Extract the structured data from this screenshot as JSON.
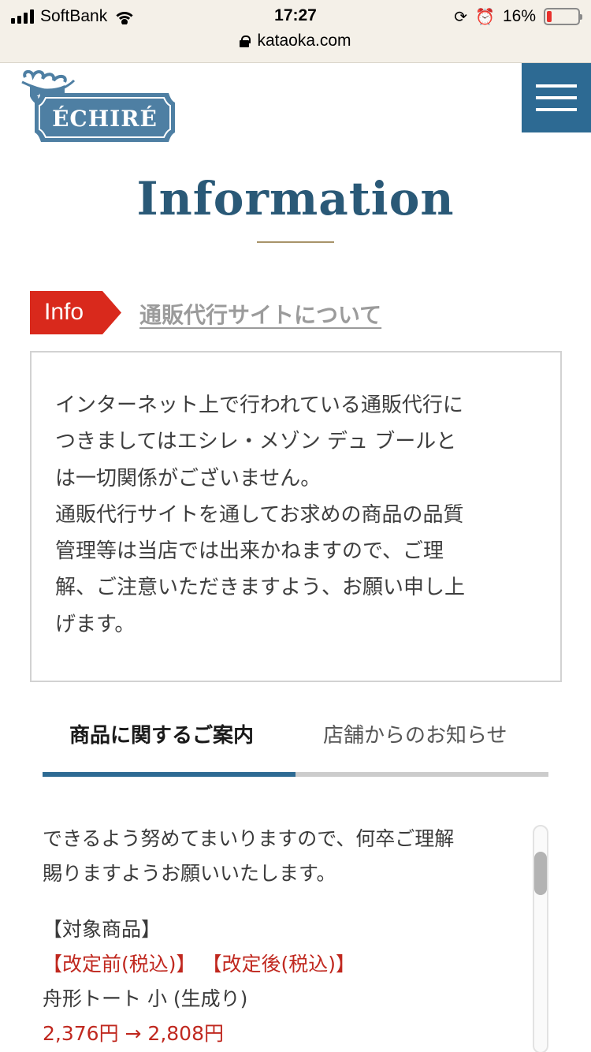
{
  "status_bar": {
    "carrier": "SoftBank",
    "time": "17:27",
    "url": "kataoka.com",
    "battery_percent": "16%",
    "battery_level": 0.16,
    "icons": [
      "signal-icon",
      "wifi-icon",
      "rotation-lock-icon",
      "alarm-icon",
      "battery-icon",
      "lock-icon"
    ]
  },
  "header": {
    "logo_text": "ÉCHIRÉ",
    "menu_icon": "hamburger-menu-icon",
    "brand_color": "#2d6a93"
  },
  "page": {
    "title": "Information"
  },
  "info_notice": {
    "tag": "Info",
    "tag_color": "#d9291c",
    "link_text": "通販代行サイトについて",
    "body_lines": [
      "インターネット上で行われている通販代行に",
      "つきましてはエシレ・メゾン デュ ブールと",
      "は一切関係がございません。",
      "通販代行サイトを通してお求めの商品の品質",
      "管理等は当店では出来かねますので、ご理",
      "解、ご注意いただきますよう、お願い申し上",
      "げます。"
    ]
  },
  "tabs": [
    {
      "label": "商品に関するご案内",
      "active": true
    },
    {
      "label": "店舗からのお知らせ",
      "active": false
    }
  ],
  "panel": {
    "lines": [
      "できるよう努めてまいりますので、何卒ご理解",
      "賜りますようお願いいたします。"
    ],
    "target_heading": "【対象商品】",
    "price_labels": "【改定前(税込)】 【改定後(税込)】",
    "product_name": "舟形トート 小 (生成り)",
    "price_change": "2,376円 → 2,808円",
    "accent_red": "#c0281f"
  }
}
